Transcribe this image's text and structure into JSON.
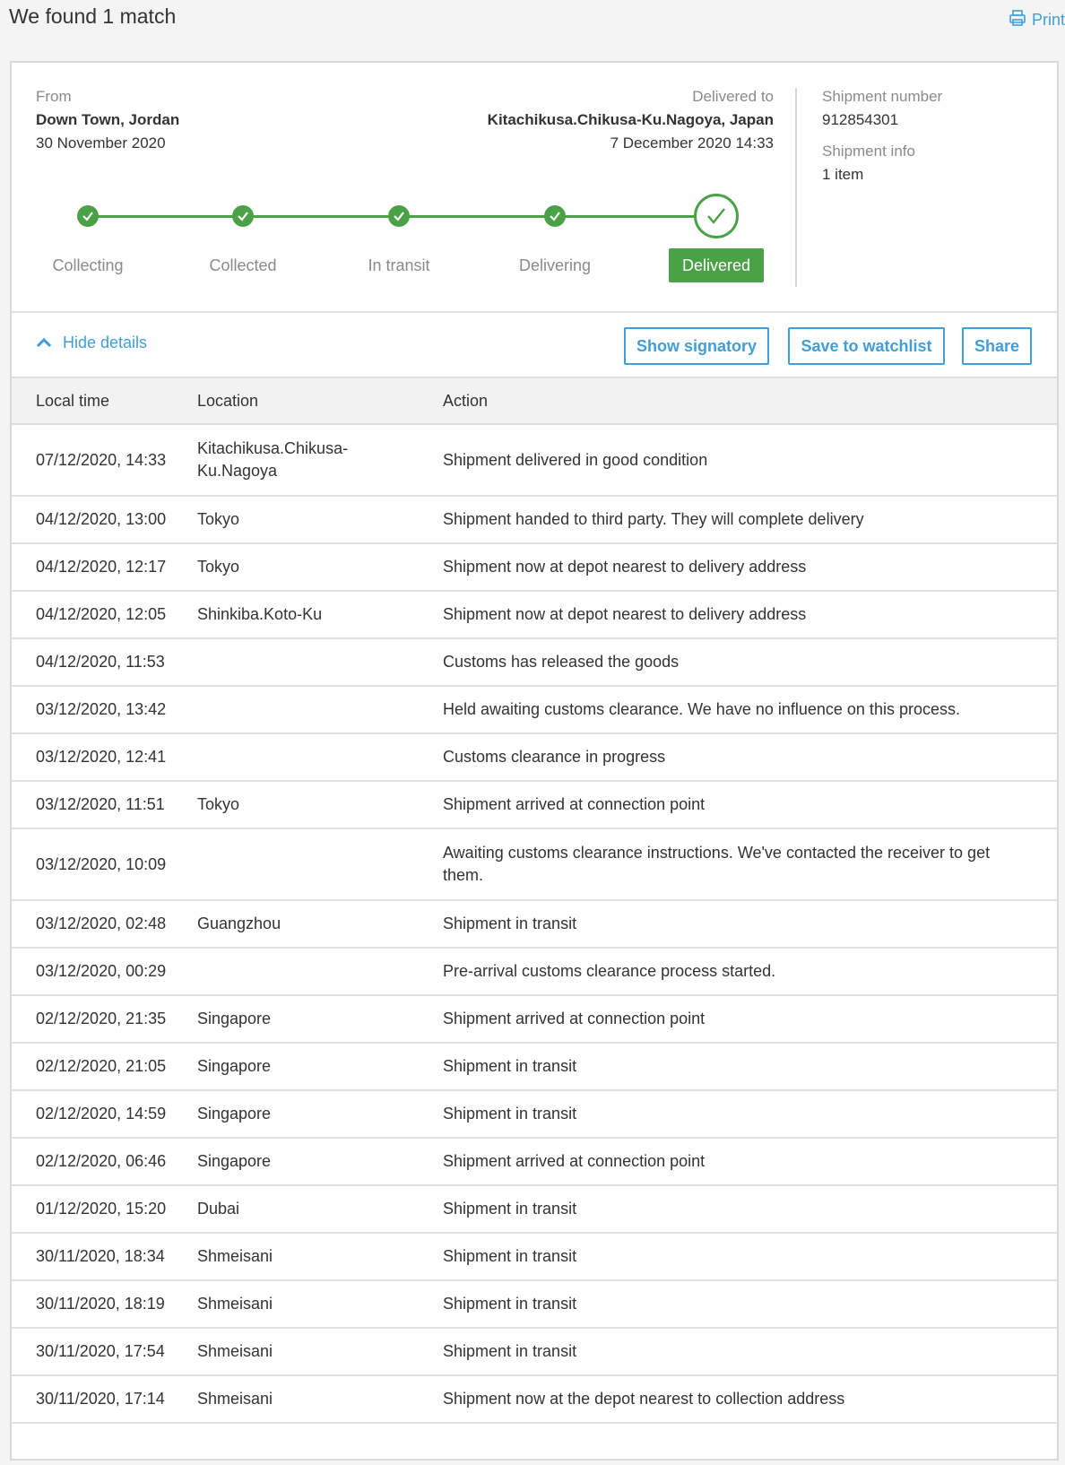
{
  "header": {
    "title": "We found 1 match",
    "print_label": "Print"
  },
  "summary": {
    "from_label": "From",
    "from_place": "Down Town, Jordan",
    "from_date": "30 November 2020",
    "to_label": "Delivered to",
    "to_place": "Kitachikusa.Chikusa-Ku.Nagoya, Japan",
    "to_date": "7 December 2020 14:33",
    "shipment_number_label": "Shipment number",
    "shipment_number": "912854301",
    "shipment_info_label": "Shipment info",
    "shipment_info": "1 item"
  },
  "progress": {
    "steps": [
      "Collecting",
      "Collected",
      "In transit",
      "Delivering",
      "Delivered"
    ],
    "current": "Delivered",
    "color": "#4aa146"
  },
  "toolbar": {
    "hide_details": "Hide details",
    "show_signatory": "Show signatory",
    "save_watchlist": "Save to watchlist",
    "share": "Share"
  },
  "table": {
    "columns": [
      "Local time",
      "Location",
      "Action"
    ],
    "rows": [
      {
        "time": "07/12/2020, 14:33",
        "location": "Kitachikusa.Chikusa-Ku.Nagoya",
        "action": "Shipment delivered in good condition"
      },
      {
        "time": "04/12/2020, 13:00",
        "location": "Tokyo",
        "action": "Shipment handed to third party. They will complete delivery"
      },
      {
        "time": "04/12/2020, 12:17",
        "location": "Tokyo",
        "action": "Shipment now at depot nearest to delivery address"
      },
      {
        "time": "04/12/2020, 12:05",
        "location": "Shinkiba.Koto-Ku",
        "action": "Shipment now at depot nearest to delivery address"
      },
      {
        "time": "04/12/2020, 11:53",
        "location": "",
        "action": "Customs has released the goods"
      },
      {
        "time": "03/12/2020, 13:42",
        "location": "",
        "action": "Held awaiting customs clearance. We have no influence on this process."
      },
      {
        "time": "03/12/2020, 12:41",
        "location": "",
        "action": "Customs clearance in progress"
      },
      {
        "time": "03/12/2020, 11:51",
        "location": "Tokyo",
        "action": "Shipment arrived at connection point"
      },
      {
        "time": "03/12/2020, 10:09",
        "location": "",
        "action": "Awaiting customs clearance instructions. We've contacted the receiver to get them."
      },
      {
        "time": "03/12/2020, 02:48",
        "location": "Guangzhou",
        "action": "Shipment in transit"
      },
      {
        "time": "03/12/2020, 00:29",
        "location": "",
        "action": "Pre-arrival customs clearance process started."
      },
      {
        "time": "02/12/2020, 21:35",
        "location": "Singapore",
        "action": "Shipment arrived at connection point"
      },
      {
        "time": "02/12/2020, 21:05",
        "location": "Singapore",
        "action": "Shipment in transit"
      },
      {
        "time": "02/12/2020, 14:59",
        "location": "Singapore",
        "action": "Shipment in transit"
      },
      {
        "time": "02/12/2020, 06:46",
        "location": "Singapore",
        "action": "Shipment arrived at connection point"
      },
      {
        "time": "01/12/2020, 15:20",
        "location": "Dubai",
        "action": "Shipment in transit"
      },
      {
        "time": "30/11/2020, 18:34",
        "location": "Shmeisani",
        "action": "Shipment in transit"
      },
      {
        "time": "30/11/2020, 18:19",
        "location": "Shmeisani",
        "action": "Shipment in transit"
      },
      {
        "time": "30/11/2020, 17:54",
        "location": "Shmeisani",
        "action": "Shipment in transit"
      },
      {
        "time": "30/11/2020, 17:14",
        "location": "Shmeisani",
        "action": "Shipment now at the depot nearest to collection address"
      }
    ]
  },
  "colors": {
    "accent": "#3f9fd6",
    "success": "#4aa146"
  }
}
